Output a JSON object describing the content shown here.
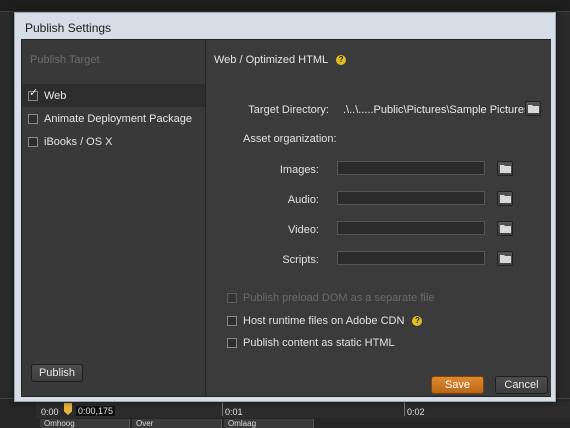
{
  "dialog": {
    "title": "Publish Settings"
  },
  "sidebar": {
    "heading": "Publish Target",
    "targets": [
      {
        "label": "Web",
        "checked": true
      },
      {
        "label": "Animate Deployment Package",
        "checked": false
      },
      {
        "label": "iBooks / OS X",
        "checked": false
      }
    ],
    "publish_label": "Publish"
  },
  "main": {
    "section_title": "Web / Optimized HTML",
    "target_directory_label": "Target Directory:",
    "target_directory_value": ".\\..\\.....Public\\Pictures\\Sample Pictures",
    "asset_org_label": "Asset organization:",
    "assets": [
      {
        "label": "Images:",
        "value": ""
      },
      {
        "label": "Audio:",
        "value": ""
      },
      {
        "label": "Video:",
        "value": ""
      },
      {
        "label": "Scripts:",
        "value": ""
      }
    ],
    "options": [
      {
        "label": "Publish preload DOM as a separate file",
        "checked": false,
        "enabled": false
      },
      {
        "label": "Host runtime files on Adobe CDN",
        "checked": false,
        "enabled": true
      },
      {
        "label": "Publish content as static HTML",
        "checked": false,
        "enabled": true
      }
    ],
    "save_label": "Save",
    "cancel_label": "Cancel"
  },
  "timeline": {
    "start": "0:00",
    "current": "0:00,175",
    "mark1": "0:01",
    "mark2": "0:02",
    "rows": [
      "Omhoog",
      "Over",
      "Omlaag"
    ]
  },
  "colors": {
    "accent": "#e08a2e",
    "help": "#e0c020",
    "title_bar": "#d6dde6"
  }
}
